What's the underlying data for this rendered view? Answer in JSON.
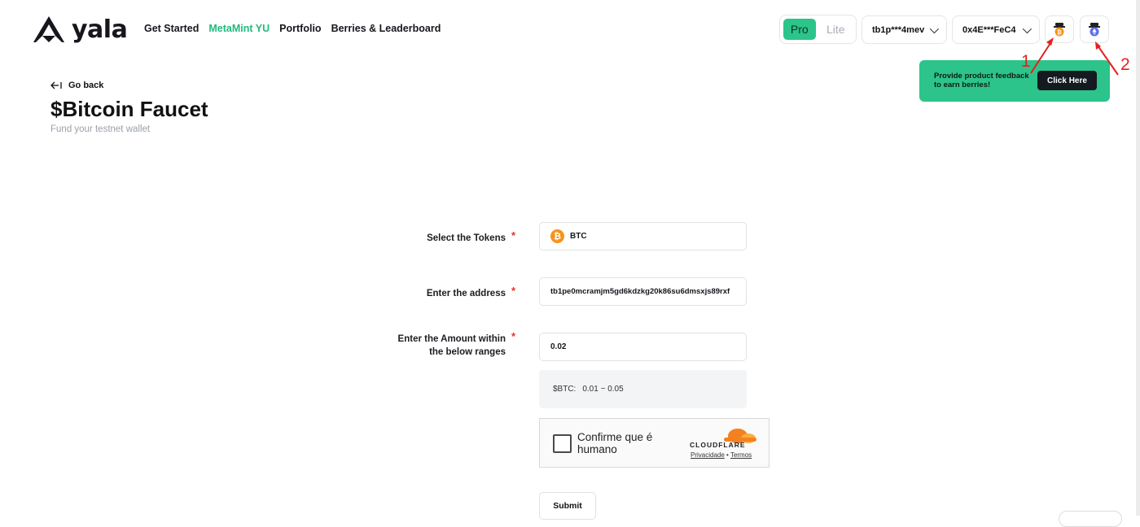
{
  "brand": {
    "name": "yala"
  },
  "nav": {
    "items": [
      {
        "label": "Get Started",
        "active": false
      },
      {
        "label": "MetaMint YU",
        "active": true
      },
      {
        "label": "Portfolio",
        "active": false
      },
      {
        "label": "Berries & Leaderboard",
        "active": false
      }
    ]
  },
  "mode": {
    "pro": "Pro",
    "lite": "Lite",
    "selected": "Pro"
  },
  "wallets": {
    "btc": "tb1p***4mev",
    "evm": "0x4E***FeC4"
  },
  "feedback": {
    "text": "Provide product feedback to earn berries!",
    "button": "Click Here"
  },
  "annotations": {
    "one": "1",
    "two": "2"
  },
  "page": {
    "back": "Go back",
    "title": "$Bitcoin Faucet",
    "subtitle": "Fund your testnet wallet"
  },
  "form": {
    "token_label": "Select the Tokens",
    "token_value": "BTC",
    "address_label": "Enter the address",
    "address_value": "tb1pe0mcramjm5gd6kdzkg20k86su6dmsxjs89rxf",
    "amount_label_line1": "Enter the Amount within",
    "amount_label_line2": "the below ranges",
    "amount_value": "0.02",
    "range_token": "$BTC:",
    "range_value": "0.01 ~ 0.05",
    "required_mark": "*",
    "submit": "Submit"
  },
  "captcha": {
    "text": "Confirme que é humano",
    "brand": "CLOUDFLARE",
    "privacy": "Privacidade",
    "separator": "•",
    "terms": "Termos"
  },
  "colors": {
    "accent": "#2cc48a",
    "active_nav": "#22b97c",
    "annotation": "#e5201e",
    "bitcoin": "#f7931a"
  }
}
